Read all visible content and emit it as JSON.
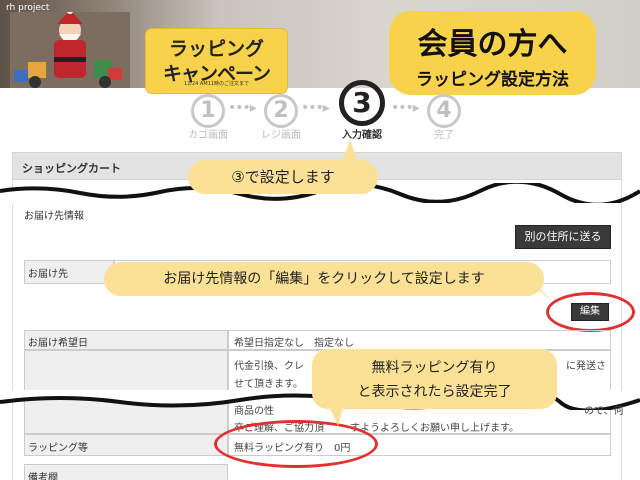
{
  "banner": {
    "logo": "rh project",
    "campaign_line1": "ラッピング",
    "campaign_line2": "キャンペーン",
    "campaign_note": "12/24 AM11時のご注文まで",
    "member_title": "会員の方へ",
    "member_subtitle": "ラッピング設定方法"
  },
  "steps": [
    {
      "num": "1",
      "label": "カゴ画面"
    },
    {
      "num": "2",
      "label": "レジ画面"
    },
    {
      "num": "3",
      "label": "入力確認"
    },
    {
      "num": "4",
      "label": "完了"
    }
  ],
  "cart": {
    "title": "ショッピングカート",
    "delivery_info_title": "お届け先情報",
    "other_address_button": "別の住所に送る",
    "delivery_to_label": "お届け先",
    "edit_button": "編集",
    "delivery_date_label": "お届け希望日",
    "delivery_date_value": "希望日指定なし　指定なし",
    "notice_line1": "代金引換、クレ",
    "notice_line1_end": "に発送さ",
    "notice_line2": "せて頂きます。",
    "notice_line3_start": "商品の性",
    "notice_line3_end": "ので、何",
    "notice_line4_start": "卒ご理解、ご協力頂",
    "notice_line4_end": "すようよろしくお願い申し上げます。",
    "wrapping_label": "ラッピング等",
    "wrapping_value": "無料ラッピング有り　0円",
    "remarks_label": "備考欄"
  },
  "callouts": {
    "step3": "③で設定します",
    "edit": "お届け先情報の「編集」をクリックして設定します",
    "wrapping_line1": "無料ラッピング有り",
    "wrapping_line2": "と表示されたら設定完了"
  },
  "colors": {
    "callout_bg": "#fae196",
    "badge_bg": "#f7d24a",
    "accent_red": "#e2302e"
  }
}
